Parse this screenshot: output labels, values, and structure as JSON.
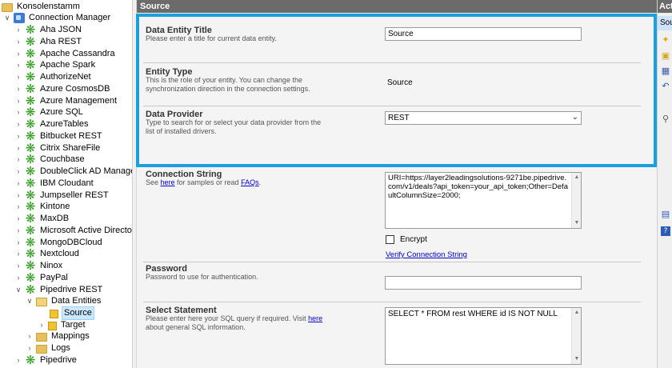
{
  "tree": {
    "root_label": "Konsolenstamm",
    "connection_manager_label": "Connection Manager",
    "connections": [
      "Aha JSON",
      "Aha REST",
      "Apache Cassandra",
      "Apache Spark",
      "AuthorizeNet",
      "Azure CosmosDB",
      "Azure Management",
      "Azure SQL",
      "AzureTables",
      "Bitbucket REST",
      "Citrix ShareFile",
      "Couchbase",
      "DoubleClick  AD Manager",
      "IBM Cloudant",
      "Jumpseller REST",
      "Kintone",
      "MaxDB",
      "Microsoft Active Directory",
      "MongoDBCloud",
      "Nextcloud",
      "Ninox",
      "PayPal",
      "Pipedrive REST"
    ],
    "data_entities_label": "Data Entities",
    "source_label": "Source",
    "target_label": "Target",
    "mappings_label": "Mappings",
    "logs_label": "Logs",
    "last_label": "Pipedrive"
  },
  "main": {
    "header": "Source",
    "data_entity_title": {
      "label": "Data Entity Title",
      "desc": "Please enter a title for current data entity.",
      "value": "Source"
    },
    "entity_type": {
      "label": "Entity Type",
      "desc": "This is the role of your entity. You can change the synchronization direction in the connection settings.",
      "value": "Source"
    },
    "data_provider": {
      "label": "Data Provider",
      "desc": "Type to search for or select your data provider from the list of installed drivers.",
      "value": "REST"
    },
    "connection_string": {
      "label": "Connection String",
      "desc_pre": "See ",
      "desc_link1": "here",
      "desc_mid": " for samples or read ",
      "desc_link2": "FAQs",
      "desc_post": ".",
      "value": "URI=https://layer2leadingsolutions-9271be.pipedrive.com/v1/deals?api_token=your_api_token;Other=DefaultColumnSize=2000;",
      "encrypt_label": "Encrypt",
      "encrypt_checked": false,
      "verify_link": "Verify Connection String"
    },
    "password": {
      "label": "Password",
      "desc": "Password to use for authentication.",
      "value": ""
    },
    "select_statement": {
      "label": "Select Statement",
      "desc_pre": "Please enter here your SQL query if required. Visit ",
      "desc_link": "here",
      "desc_post": " about general SQL information.",
      "value": "SELECT * FROM rest WHERE id IS NOT NULL"
    }
  },
  "actions": {
    "header": "Actions",
    "sub": "Source"
  },
  "colors": {
    "highlight": "#1aa0e0",
    "header_bg": "#6b6b6b",
    "selection": "#cce8ff",
    "link": "#0000cc"
  }
}
